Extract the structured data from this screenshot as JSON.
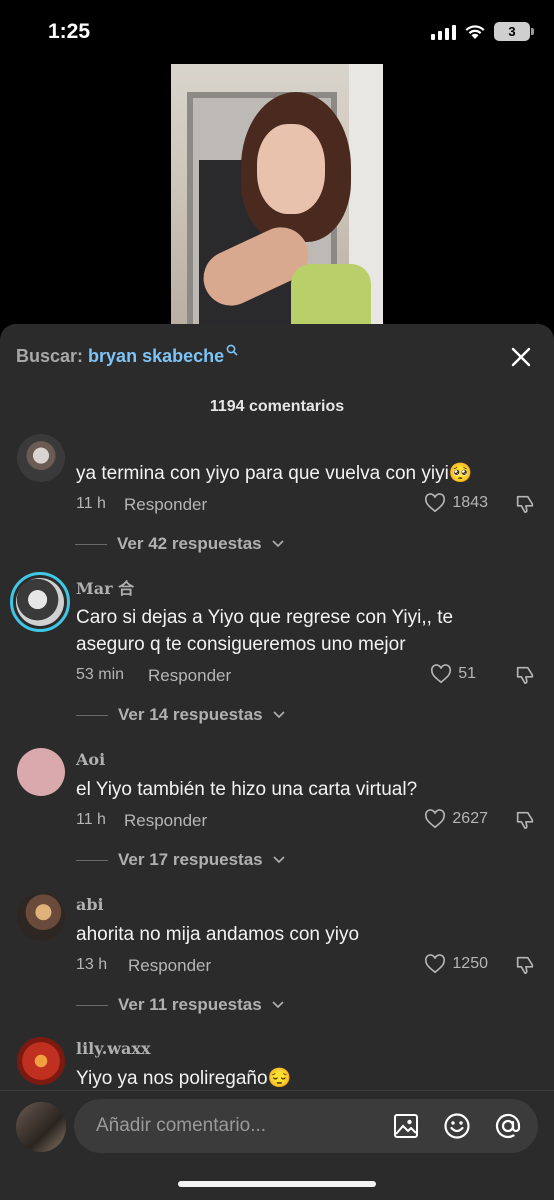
{
  "status_bar": {
    "time": "1:25",
    "battery": "3"
  },
  "sheet": {
    "search_prefix": "Buscar:",
    "search_term": "bryan skabeche",
    "comment_count": "1194 comentarios"
  },
  "comments": [
    {
      "username": "",
      "text": "ya termina con yiyo para que vuelva con yiyi🥺",
      "time": "11 h",
      "reply_label": "Responder",
      "likes": "1843",
      "replies_label": "Ver 42 respuestas"
    },
    {
      "username": "Mar 合",
      "text": "Caro si dejas a Yiyo que regrese con Yiyi,, te aseguro q te consigueremos uno mejor",
      "time": "53 min",
      "reply_label": "Responder",
      "likes": "51",
      "replies_label": "Ver 14 respuestas"
    },
    {
      "username": "Aoi",
      "text": "el Yiyo también te hizo una carta virtual?",
      "time": "11 h",
      "reply_label": "Responder",
      "likes": "2627",
      "replies_label": "Ver 17 respuestas"
    },
    {
      "username": "abi",
      "text": "ahorita no mija andamos con yiyo",
      "time": "13 h",
      "reply_label": "Responder",
      "likes": "1250",
      "replies_label": "Ver 11 respuestas"
    },
    {
      "username": "lily.waxx",
      "text": "Yiyo ya nos poliregaño😔"
    }
  ],
  "input": {
    "placeholder": "Añadir comentario..."
  },
  "colors": {
    "sheet_bg": "#2b2b2b",
    "link_blue": "#7ec3f5",
    "story_ring": "#3fc8e6"
  },
  "icons": [
    "search-icon",
    "close-icon",
    "heart-icon",
    "dislike-icon",
    "chevron-down-icon",
    "image-icon",
    "emoji-icon",
    "at-icon"
  ]
}
